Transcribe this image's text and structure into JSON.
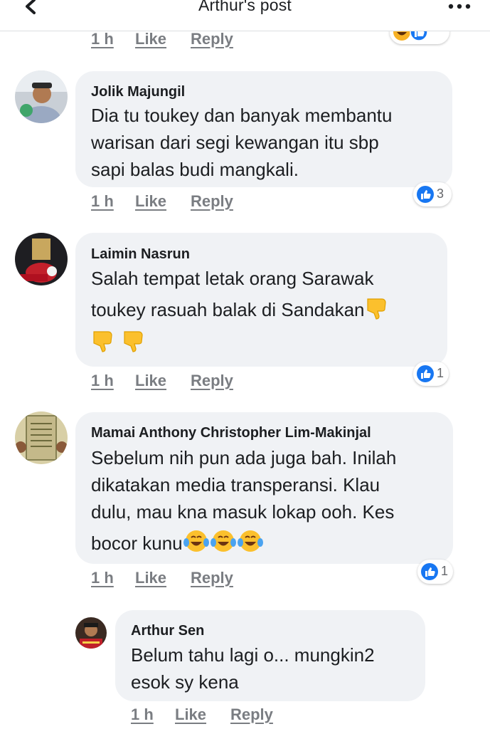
{
  "header": {
    "title": "Arthur's post"
  },
  "actions": {
    "time": "1 h",
    "like": "Like",
    "reply": "Reply"
  },
  "comments": [
    {
      "author": "Jolik Majungil",
      "lines": [
        "Dia tu toukey dan banyak membantu",
        "warisan dari segi kewangan itu sbp",
        "sapi balas budi mangkali."
      ],
      "reactions": "3"
    },
    {
      "author": "Laimin Nasrun",
      "lines": [
        "Salah tempat letak orang Sarawak",
        "toukey rasuah balak di Sandakan"
      ],
      "reactions": "1"
    },
    {
      "author": "Mamai Anthony Christopher Lim-Makinjal",
      "lines": [
        "Sebelum nih pun ada juga bah. Inilah",
        "dikatakan media transperansi. Klau",
        "dulu, mau kna masuk lokap ooh. Kes",
        "bocor kunu"
      ],
      "reactions": "1"
    },
    {
      "author": "Arthur Sen",
      "lines": [
        "Belum tahu lagi o... mungkin2",
        "esok sy kena"
      ]
    }
  ],
  "icons": {
    "back": "chevron-left-icon",
    "more": "more-dots-icon",
    "like_reaction": "like-reaction-icon",
    "haha_reaction": "haha-reaction-icon",
    "thumbs_down_emoji": "thumbs-down-emoji",
    "tears_of_joy_emoji": "tears-of-joy-emoji"
  },
  "colors": {
    "like_blue": "#1877f2",
    "bubble": "#f0f2f5",
    "meta_gray": "#7a7d82"
  }
}
